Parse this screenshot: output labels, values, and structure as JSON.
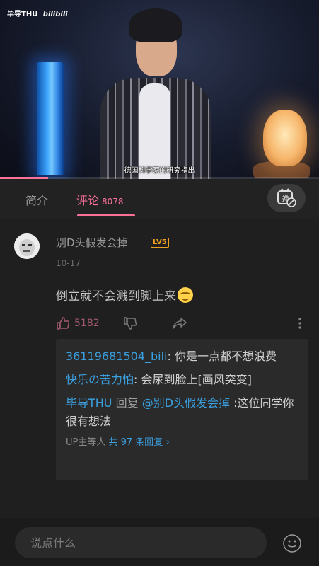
{
  "video": {
    "watermark": "毕导THU",
    "brand": "bilibili",
    "subtitle": "德国科学家的研究指出",
    "progress_fraction": 0.15
  },
  "tabs": {
    "intro_label": "简介",
    "comments_label": "评论",
    "comments_count": "8078",
    "danmaku_label": "弹"
  },
  "comment": {
    "username": "别D头假发会掉",
    "level": "LV5",
    "date": "10-17",
    "text": "倒立就不会溅到脚上来",
    "likes": "5182"
  },
  "replies": [
    {
      "user": "36119681504_bili",
      "sep": ": ",
      "text": "你是一点都不想浪费"
    },
    {
      "user": "快乐の苦力怕",
      "sep": ": ",
      "text": "会尿到脸上[画风突变]"
    },
    {
      "user": "毕导THU",
      "mid": " 回复 ",
      "mention": "@别D头假发会掉",
      "sep": " :",
      "text": "这位同学你很有想法"
    }
  ],
  "view_all": {
    "prefix": "UP主等人 ",
    "link": "共 97 条回复",
    "chevron": "›"
  },
  "input": {
    "placeholder": "说点什么"
  },
  "colors": {
    "accent": "#fb7299",
    "link": "#3aa0e0",
    "level": "#f0a020"
  }
}
